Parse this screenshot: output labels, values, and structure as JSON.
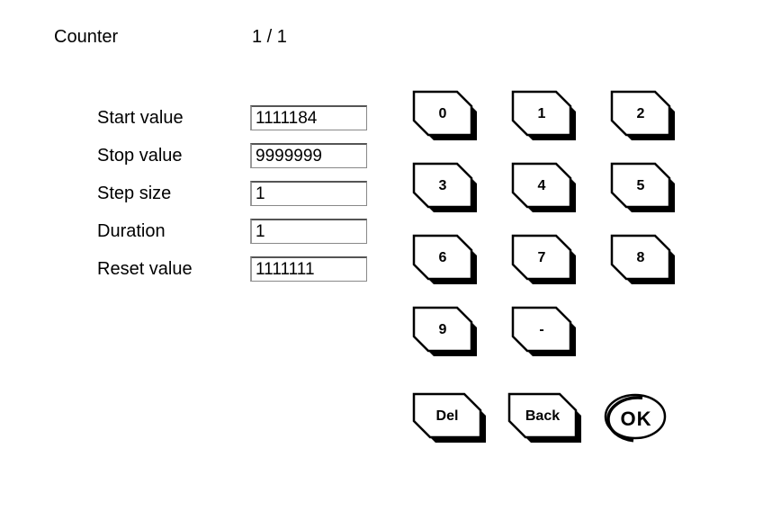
{
  "header": {
    "title": "Counter",
    "page": "1 / 1"
  },
  "fields": {
    "start_value": {
      "label": "Start value",
      "value": "1111184"
    },
    "stop_value": {
      "label": "Stop value",
      "value": "9999999"
    },
    "step_size": {
      "label": "Step size",
      "value": "1"
    },
    "duration": {
      "label": "Duration",
      "value": "1"
    },
    "reset_value": {
      "label": "Reset value",
      "value": "1111111"
    }
  },
  "keypad": {
    "row1": [
      "0",
      "1",
      "2"
    ],
    "row2": [
      "3",
      "4",
      "5"
    ],
    "row3": [
      "6",
      "7",
      "8"
    ],
    "row4": [
      "9",
      "-"
    ],
    "del": "Del",
    "back": "Back",
    "ok": "OK"
  }
}
